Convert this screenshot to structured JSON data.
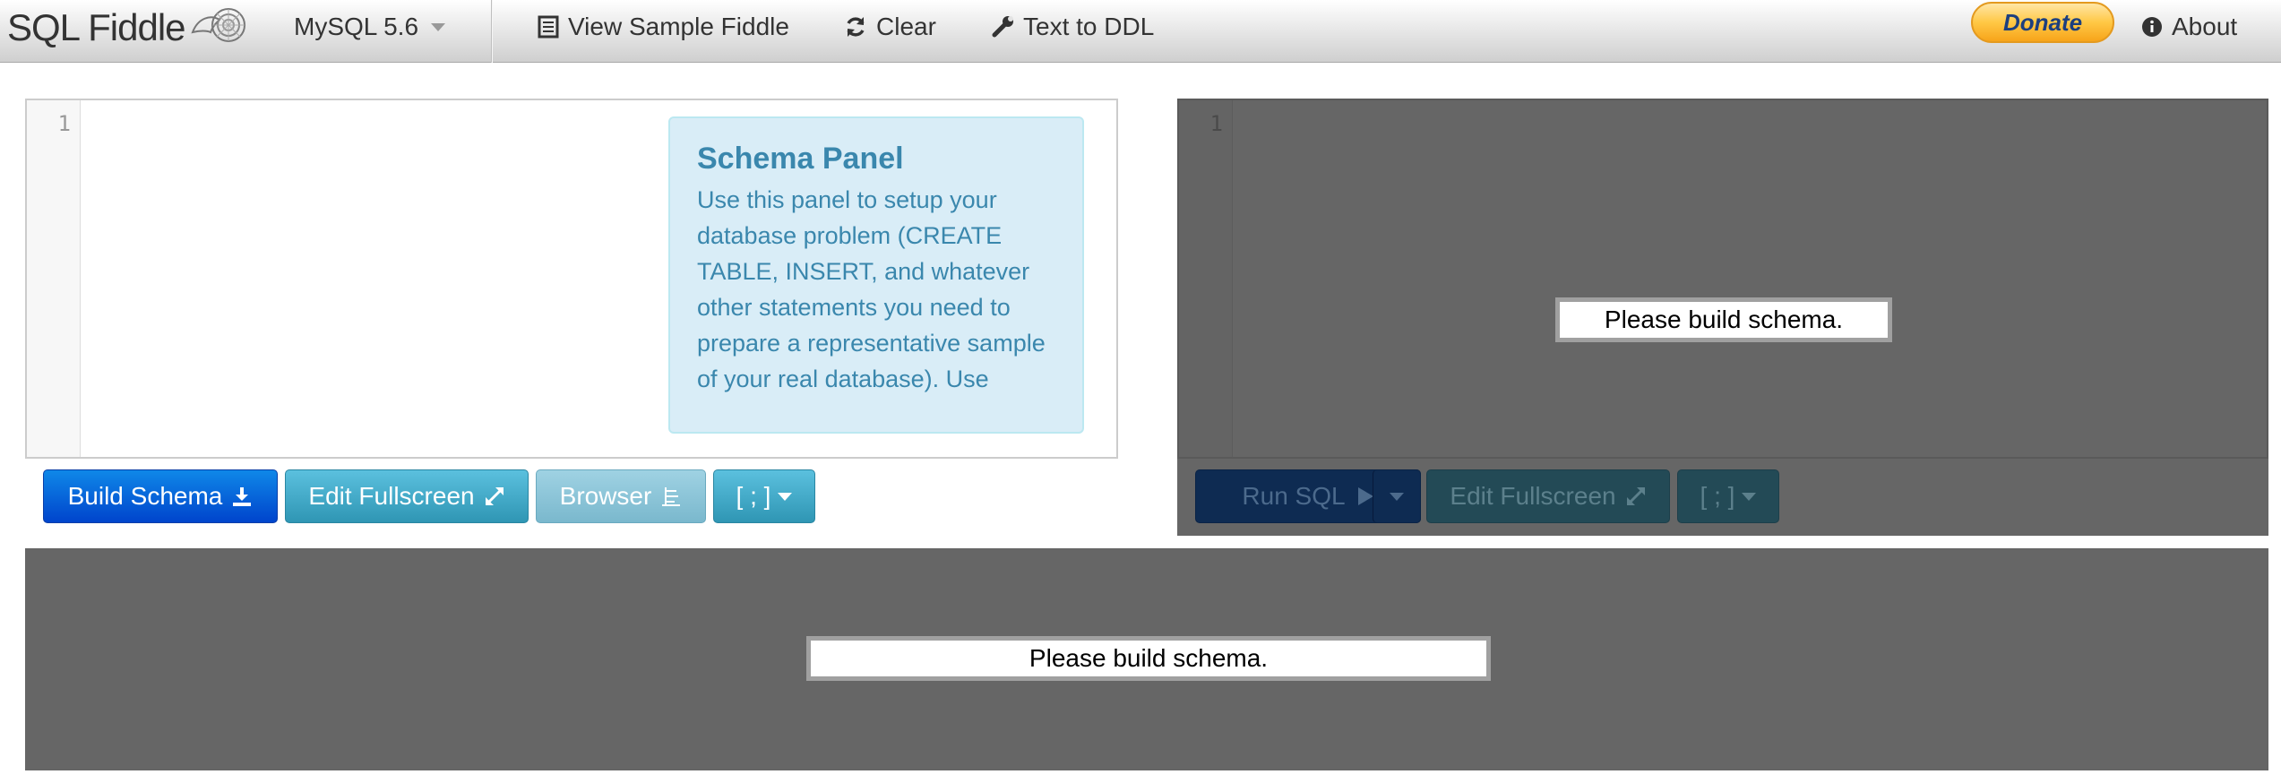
{
  "navbar": {
    "brand": "SQL Fiddle",
    "db_version": "MySQL 5.6",
    "view_sample": "View Sample Fiddle",
    "clear": "Clear",
    "text_to_ddl": "Text to DDL",
    "donate": "Donate",
    "about": "About"
  },
  "schema_panel": {
    "line_number": "1",
    "help_title": "Schema Panel",
    "help_body": "Use this panel to setup your database problem (CREATE TABLE, INSERT, and whatever other statements you need to prepare a representative sample of your real database). Use",
    "build_button": "Build Schema",
    "fullscreen_button": "Edit Fullscreen",
    "browser_button": "Browser",
    "terminator_button": "[ ; ]"
  },
  "query_panel": {
    "line_number": "1",
    "message": "Please build schema.",
    "run_button": "Run SQL",
    "fullscreen_button": "Edit Fullscreen",
    "terminator_button": "[ ; ]"
  },
  "results_panel": {
    "message": "Please build schema."
  },
  "colors": {
    "primary": "#0044cc",
    "info": "#2f96b4",
    "help_bg": "#d9edf7",
    "help_text": "#3a87ad",
    "disabled_overlay": "#666666",
    "donate": "#ffc845"
  }
}
